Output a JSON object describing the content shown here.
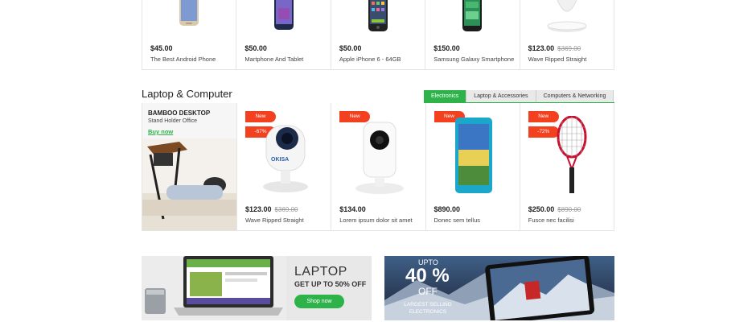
{
  "top_products": [
    {
      "price": "$45.00",
      "old_price": "",
      "name": "The Best Android Phone"
    },
    {
      "price": "$50.00",
      "old_price": "",
      "name": "Martphone And Tablet"
    },
    {
      "price": "$50.00",
      "old_price": "",
      "name": "Apple iPhone 6 - 64GB"
    },
    {
      "price": "$150.00",
      "old_price": "",
      "name": "Samsung Galaxy Smartphone"
    },
    {
      "price": "$123.00",
      "old_price": "$369.00",
      "name": "Wave Ripped Straight"
    }
  ],
  "section": {
    "title": "Laptop & Computer",
    "tabs": [
      "Electronics",
      "Laptop & Accessories",
      "Computers & Networking"
    ],
    "promo": {
      "title": "BAMBOO DESKTOP",
      "subtitle": "Stand Holder Office",
      "link": "Buy now"
    },
    "products": [
      {
        "badge": "New",
        "sale": "-67%",
        "price": "$123.00",
        "old_price": "$369.00",
        "name": "Wave Ripped Straight"
      },
      {
        "badge": "New",
        "sale": "",
        "price": "$134.00",
        "old_price": "",
        "name": "Lorem ipsum dolor sit amet"
      },
      {
        "badge": "New",
        "sale": "",
        "price": "$890.00",
        "old_price": "",
        "name": "Donec sem tellus"
      },
      {
        "badge": "New",
        "sale": "-72%",
        "price": "$250.00",
        "old_price": "$890.00",
        "name": "Fusce nec facilisi"
      }
    ],
    "camera_brand": "OKISA"
  },
  "banners": {
    "laptop": {
      "heading": "LAPTOP",
      "sub": "GET UP TO 50% OFF",
      "button": "Shop now"
    },
    "electronics": {
      "upto": "UPTO",
      "percent": "40 %",
      "off": "OFF",
      "line": "LARGEST SELLING ELECTRONICS"
    }
  },
  "colors": {
    "accent": "#2eb34a",
    "badge": "#f3411f"
  }
}
